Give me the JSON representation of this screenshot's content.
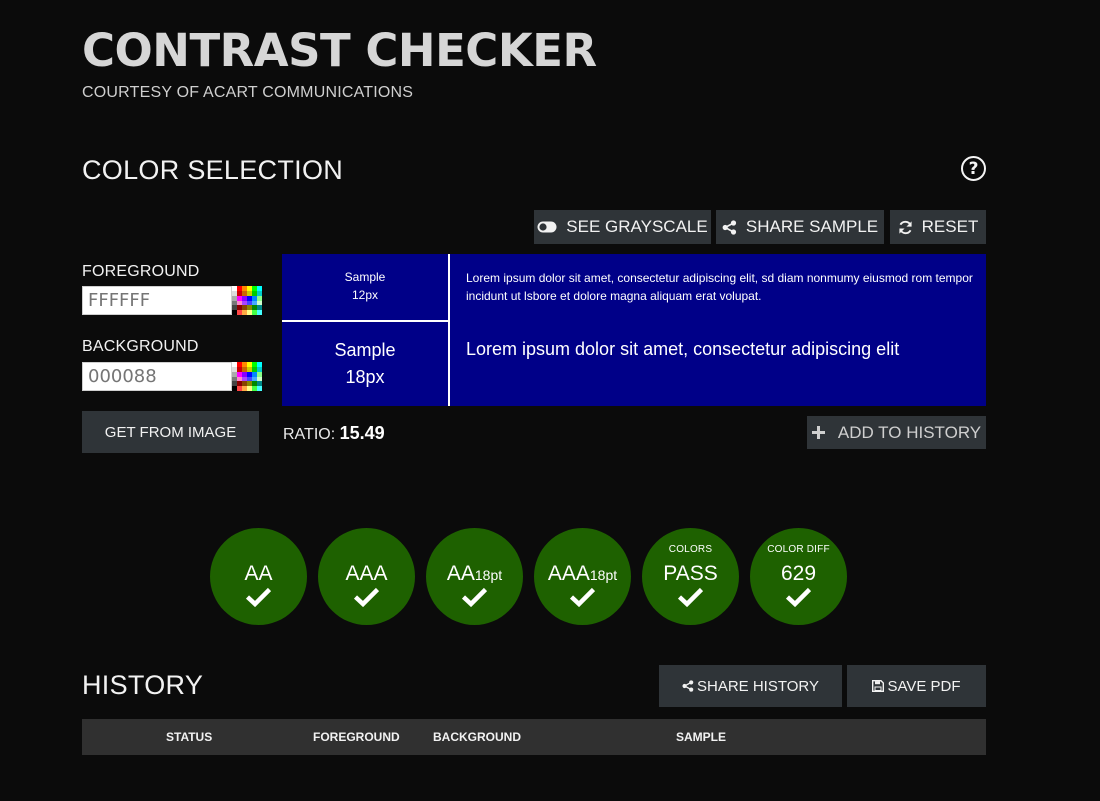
{
  "header": {
    "title": "CONTRAST CHECKER",
    "subtitle": "COURTESY OF ACART COMMUNICATIONS"
  },
  "color_selection": {
    "title": "COLOR SELECTION",
    "help_icon": "question-circle-icon",
    "toolbar": {
      "grayscale_label": "SEE GRAYSCALE",
      "share_label": "SHARE SAMPLE",
      "reset_label": "RESET"
    },
    "foreground": {
      "label": "FOREGROUND",
      "placeholder": "FFFFFF"
    },
    "background": {
      "label": "BACKGROUND",
      "placeholder": "000088"
    },
    "get_from_image_label": "GET FROM IMAGE",
    "sample": {
      "small_label_1": "Sample",
      "small_label_2": "12px",
      "large_label_1": "Sample",
      "large_label_2": "18px",
      "small_text": "Lorem ipsum dolor sit amet, consectetur adipiscing elit, sd diam nonmumy eiusmod rom tempor incidunt ut lsbore et dolore magna aliquam erat volupat.",
      "large_text": "Lorem ipsum dolor sit amet, consectetur adipiscing elit",
      "fg_color": "#ffffff",
      "bg_color": "#000088"
    },
    "ratio_label": "RATIO:",
    "ratio_value": "15.49",
    "add_history_label": "ADD TO HISTORY"
  },
  "results": {
    "pass_color": "#1e6100",
    "badges": [
      {
        "label": "AA"
      },
      {
        "label": "AAA"
      },
      {
        "label": "AA",
        "suffix": "18pt"
      },
      {
        "label": "AAA",
        "suffix": "18pt"
      },
      {
        "caption": "COLORS",
        "label": "PASS"
      },
      {
        "caption": "COLOR DIFF",
        "label": "629"
      }
    ]
  },
  "history": {
    "title": "HISTORY",
    "share_label": "SHARE HISTORY",
    "save_pdf_label": "SAVE PDF",
    "columns": [
      "STATUS",
      "FOREGROUND",
      "BACKGROUND",
      "SAMPLE"
    ]
  }
}
